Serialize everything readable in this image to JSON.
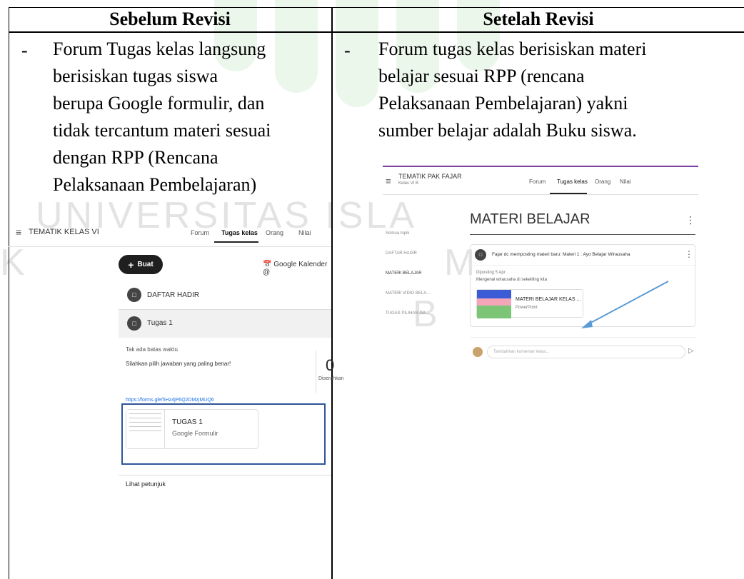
{
  "header": {
    "before": "Sebelum Revisi",
    "after": "Setelah Revisi"
  },
  "bullet": "-",
  "before_text": {
    "lines": [
      "Forum Tugas kelas langsung",
      "berisiskan tugas siswa",
      "berupa Google formulir, dan",
      "tidak tercantum materi sesuai",
      "dengan RPP (Rencana",
      "Pelaksanaan Pembelajaran)"
    ]
  },
  "after_text": {
    "lines": [
      "Forum tugas kelas berisiskan materi",
      "belajar sesuai RPP (rencana",
      "Pelaksanaan Pembelajaran) yakni",
      "sumber belajar adalah Buku siswa."
    ]
  },
  "watermark": {
    "line1": "UNIVERSITAS ISLA",
    "letters": [
      "K",
      "M",
      "B"
    ]
  },
  "shot_left": {
    "menu_icon": "menu-icon",
    "title": "TEMATIK KELAS VI",
    "tabs": [
      "Forum",
      "Tugas kelas",
      "Orang",
      "Nilai"
    ],
    "create_label": "Buat",
    "calendar_label": "Google Kalender",
    "daftar_hadir": "DAFTAR HADIR",
    "tugas_title": "Tugas 1",
    "deadline": "Tak ada batas waktu",
    "instruction": "Silahkan pilih jawaban yang paling benar!",
    "link": "https://forms.gle/5Hz4jP6Q2DMzjMUQ6",
    "count": "0",
    "count_label": "Diserahkan",
    "attachment_title": "TUGAS 1",
    "attachment_type": "Google Formulir",
    "footer": "Lihat petunjuk",
    "frame_color": "#2f5597"
  },
  "shot_right": {
    "title": "TEMATIK PAK FAJAR",
    "subtitle": "Kelas VI B",
    "tabs": [
      "Forum",
      "Tugas kelas",
      "Orang",
      "Nilai"
    ],
    "section_title": "MATERI BELAJAR",
    "sidebar": [
      "Semua topik",
      "DAFTAR HADIR",
      "MATERI BELAJAR",
      "MATERI VIDIO BELA...",
      "TUGAS PILIHAN GA..."
    ],
    "post_title": "Fajar dc memposting materi baru: Materi 1 : Ayo Belajar Wirausaha",
    "posted": "Diposting 5 Apr",
    "post_desc": "Mengenal wirausaha di sekeliling kita",
    "attachment_title": "MATERI BELAJAR KELAS ...",
    "attachment_type": "PowerPoint",
    "comment_placeholder": "Tambahkan komentar kelas...",
    "arrow_color": "#5b9bd5",
    "accent_line": "#7b3fa0"
  }
}
